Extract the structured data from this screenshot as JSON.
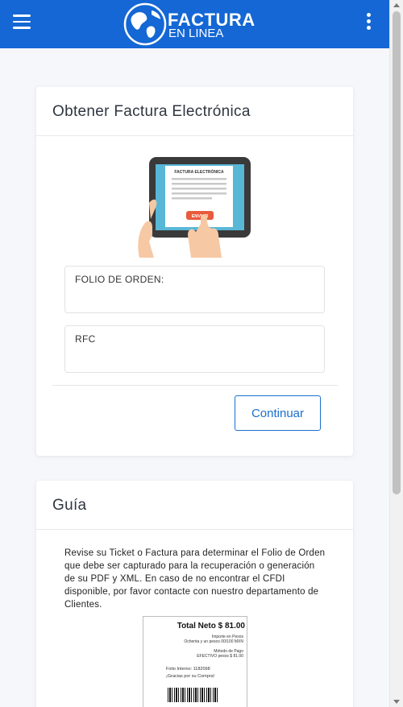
{
  "header": {
    "logo_line1": "FACTURA",
    "logo_line2": "EN LINEA",
    "bg_color": "#1467d4"
  },
  "form_card": {
    "title": "Obtener Factura Electrónica",
    "illustration": {
      "screen_title": "FACTURA ELECTRÓNICA",
      "button_text": "ENVIAR"
    },
    "fields": {
      "folio_label": "FOLIO DE ORDEN:",
      "folio_value": "",
      "rfc_label": "RFC",
      "rfc_value": ""
    },
    "continue_label": "Continuar",
    "accent_color": "#1a6fcf"
  },
  "guide_card": {
    "title": "Guía",
    "text": "Revise su Ticket o Factura para determinar el Folio de Orden que debe ser capturado para la recuperación o generación de su PDF y XML. En caso de no encontrar el CFDI disponible, por favor contacte con nuestro departamento de Clientes.",
    "ticket": {
      "total": "Total Neto $ 81.00",
      "importe": "Importe en Pesos",
      "importe_words": "Ochenta y un pesos 00/100 MXN",
      "metodo": "Método de Pago",
      "metodo_value": "EFECTIVO pesos $    81.00",
      "folio": "Folio Interno: 1182098",
      "thanks": "¡Gracias por su Compra!"
    }
  },
  "icons": {
    "menu": "hamburger-menu-icon",
    "more": "vertical-dots-icon",
    "logo": "globe-logo-icon"
  }
}
